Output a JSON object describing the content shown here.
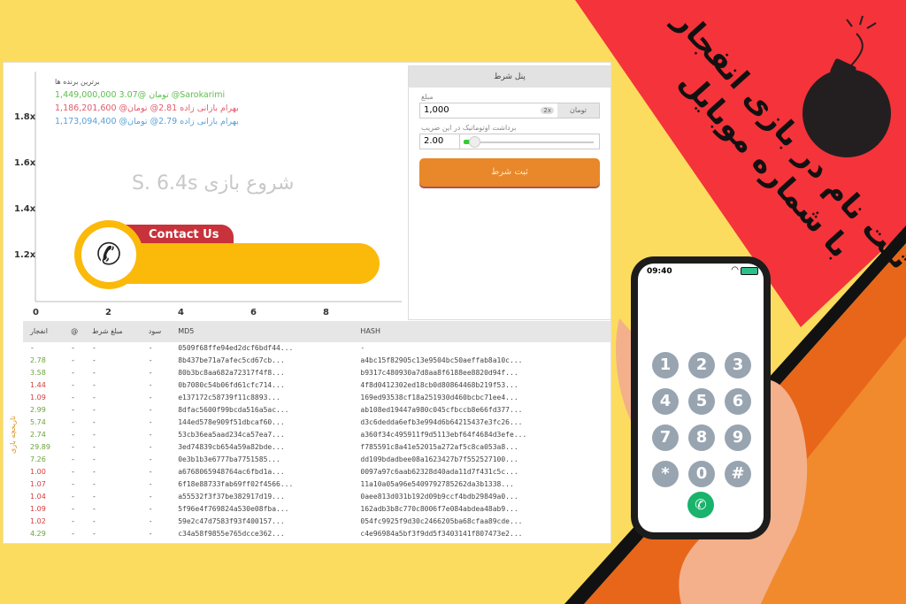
{
  "promo": {
    "headline_line1": "ثبت نام در بازی انفجار",
    "headline_line2": "با شماره موبایل",
    "colors": {
      "background": "#fcdc5f",
      "red": "#f5333a",
      "stripe": "#111111",
      "fire": "#e8661a"
    }
  },
  "chart": {
    "y_ticks": [
      "1.8x",
      "1.6x",
      "1.4x",
      "1.2x"
    ],
    "x_ticks": [
      "0",
      "2",
      "4",
      "6",
      "8"
    ],
    "countdown": "S. 6.4s شروع بازی",
    "contact_label": "Contact Us"
  },
  "winners": {
    "title": "برترین برنده ها",
    "items": [
      {
        "text": "1,449,000,000 3.07@ تومان @Sarokarimi",
        "color": "#5cbf4a"
      },
      {
        "text": "1,186,201,600 @بهرام بازانی زاده 2.81@ تومان",
        "color": "#e05a6a"
      },
      {
        "text": "1,173,094,400 @بهرام بازانی زاده 2.79@ تومان",
        "color": "#5aa0d8"
      }
    ]
  },
  "panel": {
    "title": "پنل شرط",
    "amount_label": "مبلغ",
    "amount": "1,000",
    "multiplier_badge": "2x",
    "currency": "تومان",
    "auto_label": "برداشت اوتوماتیک در این ضریب",
    "auto_value": "2.00",
    "submit": "ثبت شرط"
  },
  "history": {
    "side_label": "تاریخچه بازی",
    "columns": [
      "انفجار",
      "@",
      "مبلغ شرط",
      "سود",
      "MD5",
      "HASH"
    ],
    "rows": [
      [
        "-",
        "-",
        "-",
        "-",
        "0509f68ffe94ed2dcf6bdf44...",
        "-"
      ],
      [
        "2.78",
        "-",
        "-",
        "-",
        "8b437be71a7afec5cd67cb...",
        "a4bc15f82905c13e9504bc50aeffab8a10c..."
      ],
      [
        "3.58",
        "-",
        "-",
        "-",
        "80b3bc8aa682a72317f4f8...",
        "b9317c480930a7d8aa8f6188ee8820d94f..."
      ],
      [
        "1.44",
        "-",
        "-",
        "-",
        "0b7080c54b06fd61cfc714...",
        "4f8d0412302ed18cb0d80864468b219f53..."
      ],
      [
        "1.09",
        "-",
        "-",
        "-",
        "e137172c58739f11c8893...",
        "169ed93538cf18a251930d460bcbc71ee4..."
      ],
      [
        "2.99",
        "-",
        "-",
        "-",
        "8dfac5600f99bcda516a5ac...",
        "ab108ed19447a980c045cfbccb8e66fd377..."
      ],
      [
        "5.74",
        "-",
        "-",
        "-",
        "144ed578e909f51dbcaf60...",
        "d3c6dedda6efb3e994d6b64215437e3fc26..."
      ],
      [
        "2.74",
        "-",
        "-",
        "-",
        "53cb36ea5aad234ca57ea7...",
        "a360f34c495911f9d5113ebf64f4684d3efe..."
      ],
      [
        "29.89",
        "-",
        "-",
        "-",
        "3ed74839cb654a59a82bde...",
        "f785591c8a41e52015a272af5c8ca053a8..."
      ],
      [
        "7.26",
        "-",
        "-",
        "-",
        "0e3b1b3e6777ba7751585...",
        "dd109bdadbee08a1623427b7f552527100..."
      ],
      [
        "1.00",
        "-",
        "-",
        "-",
        "a6768065948764ac6fbd1a...",
        "0097a97c6aab62328d40ada11d7f431c5c..."
      ],
      [
        "1.07",
        "-",
        "-",
        "-",
        "6f18e88733fab69ff02f4566...",
        "11a10a05a96e5409792785262da3b1338..."
      ],
      [
        "1.04",
        "-",
        "-",
        "-",
        "a55532f3f37be382917d19...",
        "0aee813d031b192d09b9ccf4bdb29849a0..."
      ],
      [
        "1.09",
        "-",
        "-",
        "-",
        "5f96e4f769824a530e08fba...",
        "162adb3b8c770c8006f7e084abdea48ab9..."
      ],
      [
        "1.02",
        "-",
        "-",
        "-",
        "59e2c47d7583f93f400157...",
        "054fc9925f9d30c2466205ba68cfaa89cde..."
      ],
      [
        "4.29",
        "-",
        "-",
        "-",
        "c34a58f9855e765dcce362...",
        "c4e96984a5bf3f9dd5f3403141f807473e2..."
      ]
    ]
  },
  "phone": {
    "time": "09:40",
    "keys": [
      "1",
      "2",
      "3",
      "4",
      "5",
      "6",
      "7",
      "8",
      "9",
      "*",
      "0",
      "#"
    ]
  }
}
